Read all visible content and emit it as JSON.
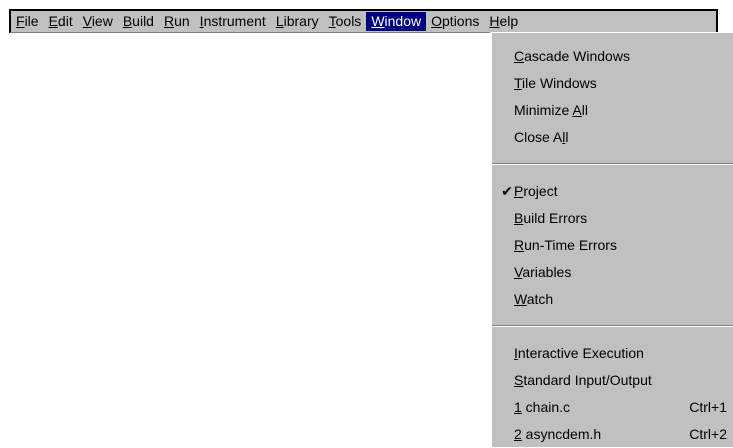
{
  "menubar": {
    "items": [
      {
        "pre": "",
        "ul": "F",
        "post": "ile"
      },
      {
        "pre": "",
        "ul": "E",
        "post": "dit"
      },
      {
        "pre": "",
        "ul": "V",
        "post": "iew"
      },
      {
        "pre": "",
        "ul": "B",
        "post": "uild"
      },
      {
        "pre": "",
        "ul": "R",
        "post": "un"
      },
      {
        "pre": "",
        "ul": "I",
        "post": "nstrument"
      },
      {
        "pre": "",
        "ul": "L",
        "post": "ibrary"
      },
      {
        "pre": "",
        "ul": "T",
        "post": "ools"
      },
      {
        "pre": "",
        "ul": "W",
        "post": "indow"
      },
      {
        "pre": "",
        "ul": "O",
        "post": "ptions"
      },
      {
        "pre": "",
        "ul": "H",
        "post": "elp"
      }
    ]
  },
  "window_menu": {
    "group1": [
      {
        "pre": "",
        "ul": "C",
        "post": "ascade Windows"
      },
      {
        "pre": "",
        "ul": "T",
        "post": "ile Windows"
      },
      {
        "pre": "Minimize ",
        "ul": "A",
        "post": "ll"
      },
      {
        "pre": "Close A",
        "ul": "l",
        "post": "l"
      }
    ],
    "group2": [
      {
        "pre": "",
        "ul": "P",
        "post": "roject",
        "check": "✔"
      },
      {
        "pre": "",
        "ul": "B",
        "post": "uild Errors"
      },
      {
        "pre": "",
        "ul": "R",
        "post": "un-Time Errors"
      },
      {
        "pre": "",
        "ul": "V",
        "post": "ariables"
      },
      {
        "pre": "",
        "ul": "W",
        "post": "atch"
      }
    ],
    "group3": [
      {
        "pre": "",
        "ul": "I",
        "post": "nteractive Execution"
      },
      {
        "pre": "",
        "ul": "S",
        "post": "tandard Input/Output"
      },
      {
        "pre": "",
        "ul": "1",
        "post": " chain.c",
        "accel": "Ctrl+1"
      },
      {
        "pre": "",
        "ul": "2",
        "post": " asyncdem.h",
        "accel": "Ctrl+2"
      }
    ]
  }
}
